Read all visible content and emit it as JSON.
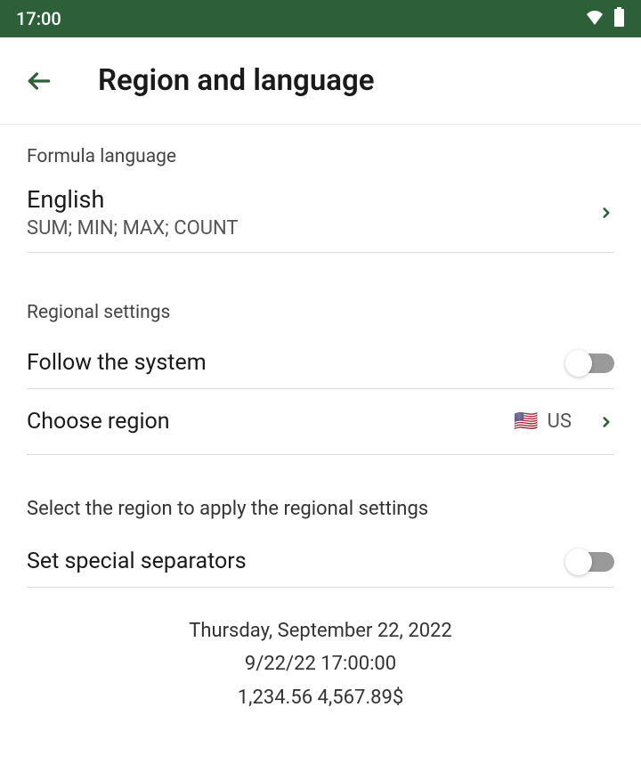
{
  "status": {
    "time": "17:00"
  },
  "header": {
    "title": "Region and language"
  },
  "formula": {
    "section_label": "Formula language",
    "language": "English",
    "example": "SUM; MIN; MAX; COUNT"
  },
  "regional": {
    "section_label": "Regional settings",
    "follow_system_label": "Follow the system",
    "choose_region_label": "Choose region",
    "region_value": "US",
    "region_flag": "🇺🇸",
    "helper_text": "Select the region to apply the regional settings",
    "separators_label": "Set special separators"
  },
  "preview": {
    "line1": "Thursday, September 22, 2022",
    "line2": "9/22/22 17:00:00",
    "line3": "1,234.56 4,567.89$"
  }
}
